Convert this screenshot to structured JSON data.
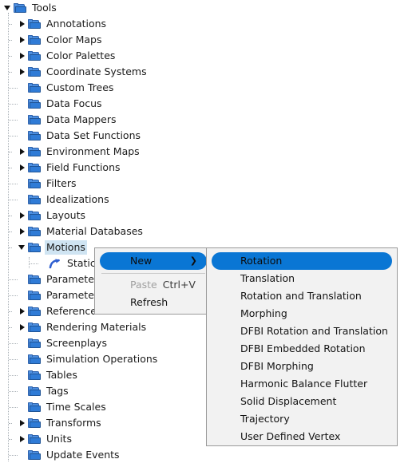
{
  "tree": {
    "root": {
      "label": "Tools",
      "icon": "folder-icon",
      "twisty": "expanded"
    },
    "items": [
      {
        "label": "Annotations",
        "icon": "folder-icon",
        "twisty": "collapsed"
      },
      {
        "label": "Color Maps",
        "icon": "folder-icon",
        "twisty": "collapsed"
      },
      {
        "label": "Color Palettes",
        "icon": "folder-icon",
        "twisty": "collapsed"
      },
      {
        "label": "Coordinate Systems",
        "icon": "folder-icon",
        "twisty": "collapsed"
      },
      {
        "label": "Custom Trees",
        "icon": "folder-icon",
        "twisty": "none"
      },
      {
        "label": "Data Focus",
        "icon": "folder-icon",
        "twisty": "none"
      },
      {
        "label": "Data Mappers",
        "icon": "folder-icon",
        "twisty": "none"
      },
      {
        "label": "Data Set Functions",
        "icon": "folder-icon",
        "twisty": "none"
      },
      {
        "label": "Environment Maps",
        "icon": "folder-icon",
        "twisty": "collapsed"
      },
      {
        "label": "Field Functions",
        "icon": "folder-icon",
        "twisty": "collapsed"
      },
      {
        "label": "Filters",
        "icon": "folder-icon",
        "twisty": "none"
      },
      {
        "label": "Idealizations",
        "icon": "folder-icon",
        "twisty": "none"
      },
      {
        "label": "Layouts",
        "icon": "folder-icon",
        "twisty": "collapsed"
      },
      {
        "label": "Material Databases",
        "icon": "folder-icon",
        "twisty": "collapsed"
      },
      {
        "label": "Motions",
        "icon": "folder-icon",
        "twisty": "expanded",
        "selected": true
      },
      {
        "label": "Static",
        "icon": "motion-icon",
        "twisty": "none",
        "child": true
      },
      {
        "label": "Parameters",
        "icon": "folder-icon",
        "twisty": "none"
      },
      {
        "label": "Parameters",
        "icon": "folder-icon",
        "twisty": "none"
      },
      {
        "label": "Reference Frames",
        "icon": "folder-icon",
        "twisty": "collapsed"
      },
      {
        "label": "Rendering Materials",
        "icon": "folder-icon",
        "twisty": "collapsed"
      },
      {
        "label": "Screenplays",
        "icon": "folder-icon",
        "twisty": "none"
      },
      {
        "label": "Simulation Operations",
        "icon": "folder-icon",
        "twisty": "none"
      },
      {
        "label": "Tables",
        "icon": "folder-icon",
        "twisty": "none"
      },
      {
        "label": "Tags",
        "icon": "folder-icon",
        "twisty": "none"
      },
      {
        "label": "Time Scales",
        "icon": "folder-icon",
        "twisty": "none"
      },
      {
        "label": "Transforms",
        "icon": "folder-icon",
        "twisty": "collapsed"
      },
      {
        "label": "Units",
        "icon": "folder-icon",
        "twisty": "collapsed"
      },
      {
        "label": "Update Events",
        "icon": "folder-icon",
        "twisty": "none"
      }
    ]
  },
  "context_menu": {
    "items": [
      {
        "label": "New",
        "highlight": true,
        "has_submenu": true,
        "accel": ""
      },
      {
        "label": "Paste",
        "disabled": true,
        "has_submenu": false,
        "accel": "Ctrl+V"
      },
      {
        "label": "Refresh",
        "disabled": false,
        "has_submenu": false,
        "accel": ""
      }
    ],
    "submenu_arrow_glyph": "❯"
  },
  "submenu": {
    "items": [
      {
        "label": "Rotation",
        "highlight": true
      },
      {
        "label": "Translation"
      },
      {
        "label": "Rotation and Translation"
      },
      {
        "label": "Morphing"
      },
      {
        "label": "DFBI Rotation and Translation"
      },
      {
        "label": "DFBI Embedded Rotation"
      },
      {
        "label": "DFBI Morphing"
      },
      {
        "label": "Harmonic Balance Flutter"
      },
      {
        "label": "Solid Displacement"
      },
      {
        "label": "Trajectory"
      },
      {
        "label": "User Defined Vertex"
      }
    ]
  },
  "colors": {
    "selection_blue": "#0a76d4",
    "tree_selection": "#cfe4f2",
    "folder_blue": "#2f7bd6",
    "menu_background": "#f2f2f2"
  }
}
